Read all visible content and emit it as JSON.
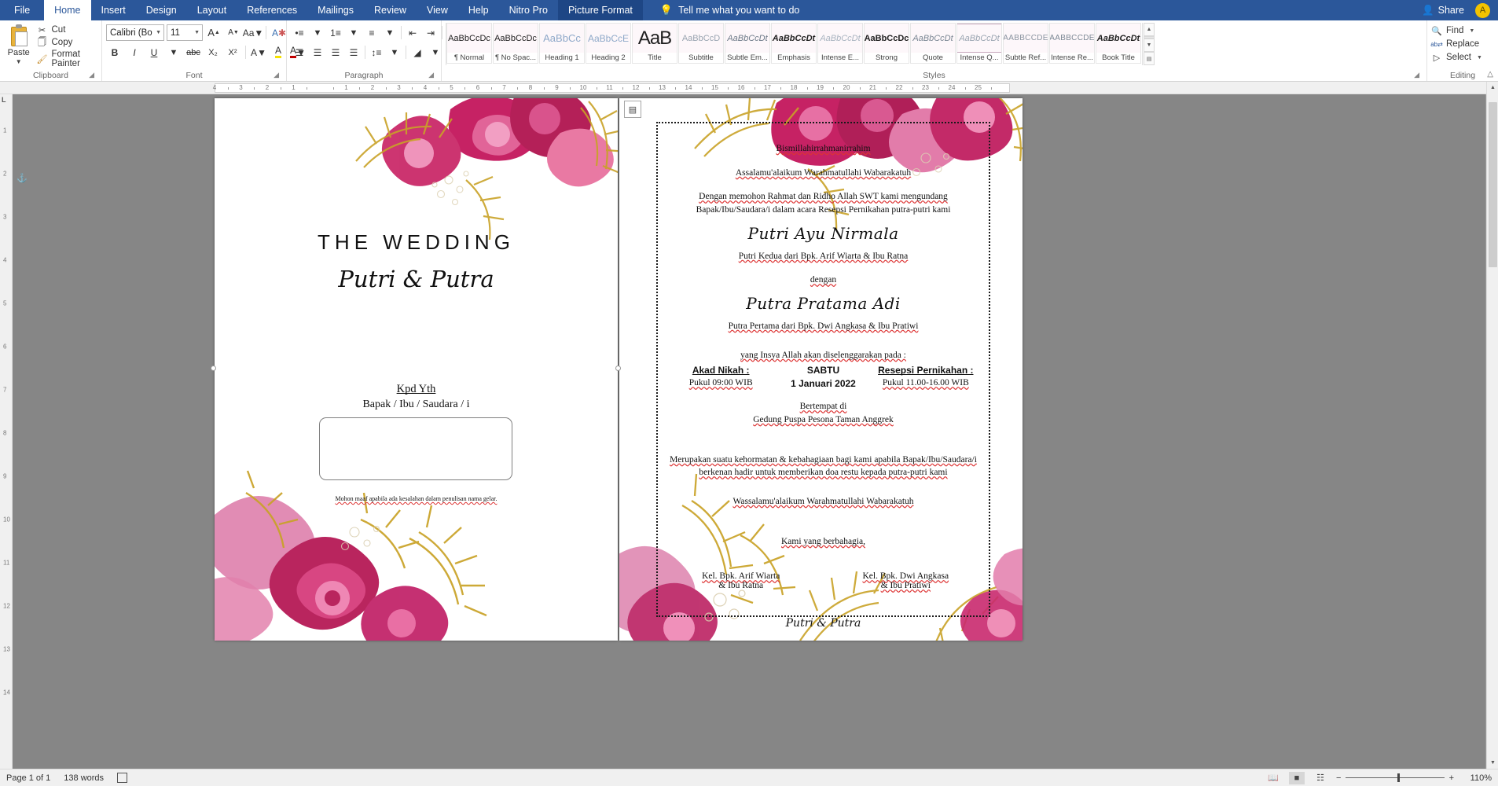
{
  "titlebar": {
    "tabs": [
      {
        "label": "File",
        "active": false
      },
      {
        "label": "Home",
        "active": true
      },
      {
        "label": "Insert",
        "active": false
      },
      {
        "label": "Design",
        "active": false
      },
      {
        "label": "Layout",
        "active": false
      },
      {
        "label": "References",
        "active": false
      },
      {
        "label": "Mailings",
        "active": false
      },
      {
        "label": "Review",
        "active": false
      },
      {
        "label": "View",
        "active": false
      },
      {
        "label": "Help",
        "active": false
      },
      {
        "label": "Nitro Pro",
        "active": false
      },
      {
        "label": "Picture Format",
        "active": false
      }
    ],
    "tellme": "Tell me what you want to do",
    "tellme_icon": "lightbulb-icon",
    "share": "Share",
    "share_icon": "person-share-icon",
    "account_initial": "A"
  },
  "ribbon": {
    "clipboard": {
      "label": "Clipboard",
      "paste": "Paste",
      "cut": "Cut",
      "copy": "Copy",
      "format_painter": "Format Painter"
    },
    "font": {
      "label": "Font",
      "font_name": "Calibri (Body",
      "font_size": "11",
      "grow": "A",
      "shrink": "A",
      "change_case": "Aa",
      "clear_formatting": "A",
      "bold": "B",
      "italic": "I",
      "underline": "U",
      "strikethrough": "abc",
      "subscript": "X₂",
      "superscript": "X²",
      "text_effects": "A",
      "highlight": "A",
      "font_color": "A"
    },
    "paragraph": {
      "label": "Paragraph",
      "bullets": "bullets-icon",
      "numbering": "numbering-icon",
      "multilevel": "multilevel-list-icon",
      "decrease_indent": "decrease-indent-icon",
      "increase_indent": "increase-indent-icon",
      "sort": "sort-icon",
      "show_marks": "¶",
      "align_left": "align-left-icon",
      "align_center": "align-center-icon",
      "align_right": "align-right-icon",
      "justify": "justify-icon",
      "line_spacing": "line-spacing-icon",
      "shading": "shading-icon",
      "borders": "borders-icon"
    },
    "styles": {
      "label": "Styles",
      "items": [
        {
          "preview": "AaBbCcDc",
          "name": "¶ Normal"
        },
        {
          "preview": "AaBbCcDc",
          "name": "¶ No Spac..."
        },
        {
          "preview": "AaBbCc",
          "name": "Heading 1"
        },
        {
          "preview": "AaBbCcE",
          "name": "Heading 2"
        },
        {
          "preview": "AaB",
          "name": "Title"
        },
        {
          "preview": "AaBbCcD",
          "name": "Subtitle"
        },
        {
          "preview": "AaBbCcDt",
          "name": "Subtle Em..."
        },
        {
          "preview": "AaBbCcDt",
          "name": "Emphasis"
        },
        {
          "preview": "AaBbCcDt",
          "name": "Intense E..."
        },
        {
          "preview": "AaBbCcDc",
          "name": "Strong"
        },
        {
          "preview": "AaBbCcDt",
          "name": "Quote"
        },
        {
          "preview": "AaBbCcDt",
          "name": "Intense Q..."
        },
        {
          "preview": "AABBCCDE",
          "name": "Subtle Ref..."
        },
        {
          "preview": "AABBCCDE",
          "name": "Intense Re..."
        },
        {
          "preview": "AaBbCcDt",
          "name": "Book Title"
        }
      ]
    },
    "editing": {
      "label": "Editing",
      "find": "Find",
      "replace": "Replace",
      "select": "Select",
      "find_icon": "magnifier-icon",
      "replace_icon": "replace-icon",
      "select_icon": "cursor-select-icon"
    },
    "collapse_icon": "collapse-ribbon-icon"
  },
  "rulers": {
    "h_labels": [
      "4",
      "3",
      "2",
      "1",
      "",
      "1",
      "2",
      "3",
      "4",
      "5",
      "6",
      "7",
      "8",
      "9",
      "10",
      "11",
      "12",
      "13",
      "14",
      "15",
      "16",
      "17",
      "18",
      "19",
      "20",
      "21",
      "22",
      "23",
      "24",
      "25"
    ],
    "v_labels": [
      "1",
      "2",
      "3",
      "4",
      "5",
      "6",
      "7",
      "8",
      "9",
      "10",
      "11",
      "12",
      "13",
      "14"
    ],
    "corner": "L"
  },
  "document": {
    "left_page": {
      "title": "THE WEDDING",
      "couple": "Putri & Putra",
      "kpd_line1": "Kpd Yth",
      "kpd_line2": "Bapak / Ibu / Saudara / i",
      "note": "Mohon maaf apabila ada kesalahan dalam penulisan nama gelar."
    },
    "right_page": {
      "bismillah": "Bismillahirrahmanirrahim",
      "salam": "Assalamu'alaikum Warahmatullahi Wabarakatuh",
      "intro_line1": "Dengan memohon Rahmat dan Ridho Allah SWT kami mengundang",
      "intro_line2": "Bapak/Ibu/Saudara/i dalam acara Resepsi Pernikahan putra-putri kami",
      "bride_name": "Putri Ayu Nirmala",
      "bride_parents": "Putri Kedua dari Bpk. Arif Wiarta & Ibu Ratna",
      "dengan": "dengan",
      "groom_name": "Putra Pratama Adi",
      "groom_parents": "Putra Pertama dari Bpk. Dwi Angkasa & Ibu Pratiwi",
      "yang_insya": "yang Insya Allah akan diselenggarakan pada :",
      "akad_title": "Akad Nikah :",
      "akad_time": "Pukul 09:00 WIB",
      "day": "SABTU",
      "date": "1 Januari 2022",
      "resepsi_title": "Resepsi Pernikahan :",
      "resepsi_time": "Pukul 11.00-16.00 WIB",
      "bertempat": "Bertempat di",
      "venue": "Gedung Puspa Pesona Taman Anggrek",
      "closing_line1": "Merupakan suatu kehormatan & kebahagiaan bagi kami apabila Bapak/Ibu/Saudara/i",
      "closing_line2": "berkenan hadir untuk memberikan doa restu kepada putra-putri kami",
      "wassalam": "Wassalamu'alaikum Warahmatullahi Wabarakatuh",
      "kami": "Kami yang berbahagia,",
      "family_left_1": "Kel. Bpk. Arif Wiarta",
      "family_left_2": "& Ibu Ratna",
      "family_right_1": "Kel. Bpk. Dwi Angkasa",
      "family_right_2": "& Ibu Pratiwi",
      "signature": "Putri & Putra"
    },
    "picture_layout_icon": "layout-options-icon",
    "anchor_icon": "object-anchor-icon"
  },
  "statusbar": {
    "page": "Page 1 of 1",
    "words": "138 words",
    "proofing_icon": "proofing-errors-icon",
    "view_read": "read-mode-icon",
    "view_print": "print-layout-icon",
    "view_web": "web-layout-icon",
    "zoom_out": "−",
    "zoom_in": "+",
    "zoom": "110%"
  },
  "colors": {
    "ribbon_blue": "#2b579a",
    "accent_pink": "#c2185b",
    "gold": "#c9a227",
    "spell_red": "#dd3333",
    "page_bg": "#868686"
  }
}
